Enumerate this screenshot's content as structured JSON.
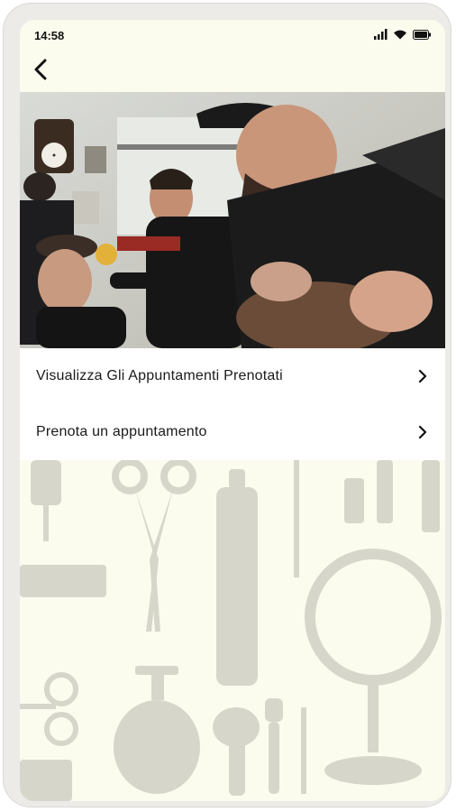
{
  "status_bar": {
    "time": "14:58",
    "icons": [
      "signal-icon",
      "wifi-icon",
      "battery-icon"
    ]
  },
  "nav": {
    "back_icon": "chevron-left-icon"
  },
  "hero": {
    "description_icon": "barbershop-photo"
  },
  "menu": {
    "items": [
      {
        "label": "Visualizza Gli Appuntamenti Prenotati",
        "icon": "chevron-right-icon"
      },
      {
        "label": "Prenota un appuntamento",
        "icon": "chevron-right-icon"
      }
    ]
  },
  "colors": {
    "background": "#fbfbee",
    "pattern": "#d6d6ca",
    "text": "#1b1b1b"
  }
}
